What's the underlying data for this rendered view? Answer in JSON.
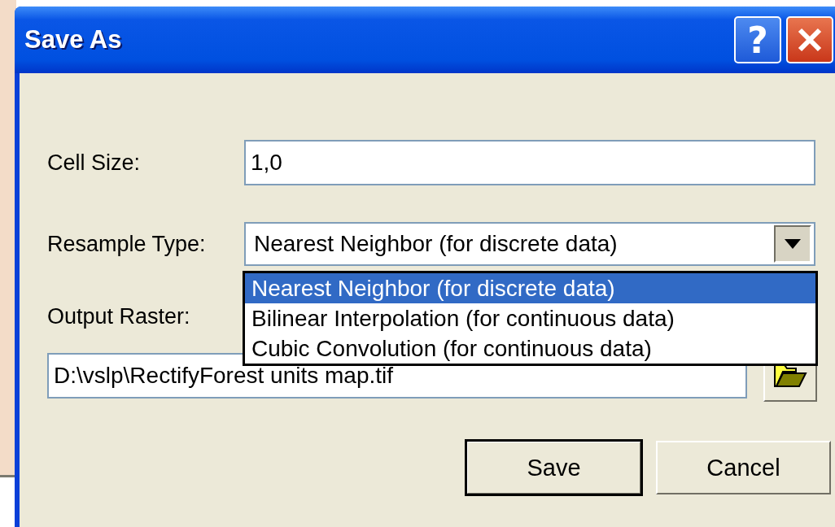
{
  "window": {
    "title": "Save As",
    "title_buttons": [
      {
        "kind": "help",
        "label": "?"
      },
      {
        "kind": "close"
      }
    ]
  },
  "cell_size": {
    "label": "Cell Size:",
    "value": "1,0"
  },
  "resample_type": {
    "label": "Resample Type:",
    "value": "Nearest Neighbor (for discrete data)",
    "expanded": true,
    "options": [
      {
        "label": "Nearest Neighbor (for discrete data)",
        "selected": true
      },
      {
        "label": "Bilinear Interpolation (for continuous data)",
        "selected": false
      },
      {
        "label": "Cubic Convolution (for continuous data)",
        "selected": false
      }
    ]
  },
  "output_raster": {
    "label": "Output Raster:",
    "value": "D:\\vslp\\RectifyForest units map.tif"
  },
  "buttons": [
    {
      "label": "Save",
      "default": true
    },
    {
      "label": "Cancel",
      "default": false
    }
  ]
}
